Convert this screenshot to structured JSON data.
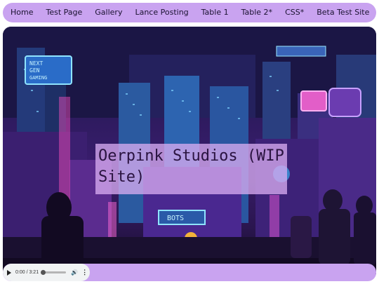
{
  "nav": {
    "items": [
      {
        "label": "Home",
        "name": "nav-home"
      },
      {
        "label": "Test Page",
        "name": "nav-test-page"
      },
      {
        "label": "Gallery",
        "name": "nav-gallery"
      },
      {
        "label": "Lance Posting",
        "name": "nav-lance-posting"
      },
      {
        "label": "Table 1",
        "name": "nav-table-1"
      },
      {
        "label": "Table 2*",
        "name": "nav-table-2"
      },
      {
        "label": "CSS*",
        "name": "nav-css"
      },
      {
        "label": "Beta Test Site",
        "name": "nav-beta-test-site"
      }
    ]
  },
  "hero": {
    "title_line1": "Oerpink Studios (WIP",
    "title_line2": "Site)",
    "sign_left": "NEXT GEN GAMING",
    "sign_bots": "BOTS"
  },
  "audio": {
    "time": "0:00 / 3:21",
    "progress": 0.0
  },
  "colors": {
    "nav_bg": "#c9a3f0",
    "title_box": "#d6aaf0"
  }
}
